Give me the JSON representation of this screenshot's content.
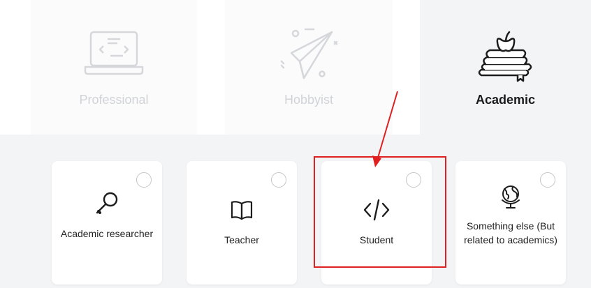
{
  "categories": [
    {
      "label": "Professional",
      "icon": "laptop-code-icon",
      "selected": false
    },
    {
      "label": "Hobbyist",
      "icon": "paper-plane-icon",
      "selected": false
    },
    {
      "label": "Academic",
      "icon": "books-apple-icon",
      "selected": true
    }
  ],
  "options": [
    {
      "label": "Academic researcher",
      "icon": "magnifier-icon"
    },
    {
      "label": "Teacher",
      "icon": "open-book-icon"
    },
    {
      "label": "Student",
      "icon": "code-icon"
    },
    {
      "label": "Something else (But related to academics)",
      "icon": "globe-icon"
    }
  ],
  "colors": {
    "annotation": "#e02020",
    "inactive_label": "#d1d3d8",
    "active_label": "#1c1c1c"
  }
}
